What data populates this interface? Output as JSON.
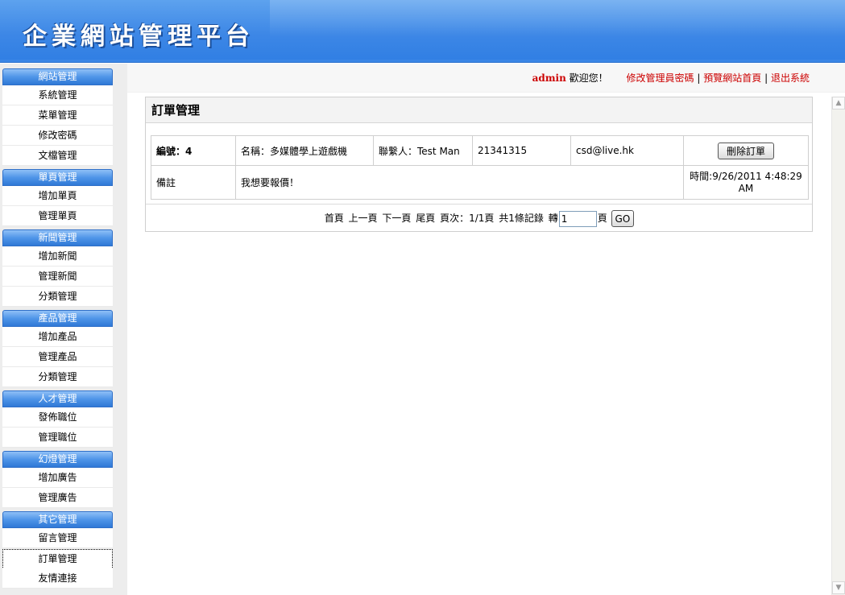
{
  "header": {
    "title": "企業網站管理平台"
  },
  "userbar": {
    "admin_name": "admin",
    "welcome": "歡迎您！",
    "link_change_password": "修改管理員密碼",
    "link_preview_home": "預覽網站首頁",
    "link_logout": "退出系統",
    "separator": "|"
  },
  "sidebar": {
    "sections": [
      {
        "title": "網站管理",
        "items": [
          "系統管理",
          "菜單管理",
          "修改密碼",
          "文檔管理"
        ]
      },
      {
        "title": "單頁管理",
        "items": [
          "增加單頁",
          "管理單頁"
        ]
      },
      {
        "title": "新聞管理",
        "items": [
          "增加新聞",
          "管理新聞",
          "分類管理"
        ]
      },
      {
        "title": "產品管理",
        "items": [
          "增加產品",
          "管理產品",
          "分類管理"
        ]
      },
      {
        "title": "人才管理",
        "items": [
          "發佈職位",
          "管理職位"
        ]
      },
      {
        "title": "幻燈管理",
        "items": [
          "增加廣告",
          "管理廣告"
        ]
      },
      {
        "title": "其它管理",
        "items": [
          "留言管理",
          "訂單管理",
          "友情連接"
        ]
      }
    ],
    "active_item": "訂單管理"
  },
  "main": {
    "title": "訂單管理",
    "order": {
      "id_label": "編號：4",
      "name_label": "名稱：多媒體學上遊戲機",
      "contact_label": "聯繫人：Test Man",
      "phone": "21341315",
      "email": "csd@live.hk",
      "delete_button": "刪除訂單",
      "remark_label": "備註",
      "remark_text": "我想要報價！",
      "time_label": "時間:9/26/2011 4:48:29 AM"
    },
    "pager": {
      "first": "首頁",
      "prev": "上一頁",
      "next": "下一頁",
      "last": "尾頁",
      "page_info": "頁次：1/1頁",
      "total": "共1條記錄",
      "goto_label": "轉",
      "page_input_value": "1",
      "page_suffix": "頁",
      "go_button": "GO"
    }
  },
  "colors": {
    "header_blue": "#3d87e6",
    "link_red": "#cc0000",
    "sidebar_bg": "#ededed"
  }
}
